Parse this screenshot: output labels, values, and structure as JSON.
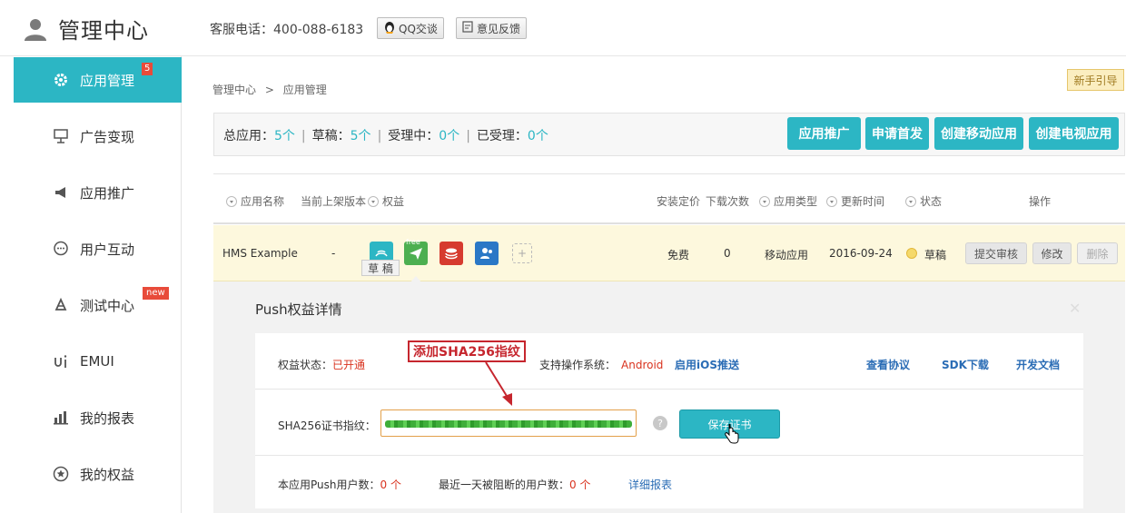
{
  "header": {
    "title": "管理中心",
    "hotline": "客服电话：400-088-6183",
    "qq_label": "QQ交谈",
    "feedback_label": "意见反馈"
  },
  "sidebar": {
    "items": [
      {
        "label": "应用管理",
        "icon": "gear-icon",
        "badge": "5"
      },
      {
        "label": "广告变现",
        "icon": "billboard-icon"
      },
      {
        "label": "应用推广",
        "icon": "megaphone-icon"
      },
      {
        "label": "用户互动",
        "icon": "chat-bubble-icon"
      },
      {
        "label": "测试中心",
        "icon": "test-icon",
        "badge": "new"
      },
      {
        "label": "EMUI",
        "icon": "emui-icon"
      },
      {
        "label": "我的报表",
        "icon": "bar-chart-icon"
      },
      {
        "label": "我的权益",
        "icon": "star-circle-icon"
      }
    ]
  },
  "breadcrumb": {
    "root": "管理中心",
    "sep": ">",
    "current": "应用管理"
  },
  "guide_label": "新手引导",
  "stats": {
    "total_label": "总应用：",
    "total_value": "5个",
    "draft_label": "草稿：",
    "draft_value": "5个",
    "pending_label": "受理中：",
    "pending_value": "0个",
    "accepted_label": "已受理：",
    "accepted_value": "0个"
  },
  "actions": [
    "应用推广",
    "申请首发",
    "创建移动应用",
    "创建电视应用"
  ],
  "table": {
    "headers": {
      "name": "应用名称",
      "version": "当前上架版本",
      "rights": "权益",
      "price": "安装定价",
      "downloads": "下载次数",
      "type": "应用类型",
      "updated": "更新时间",
      "status": "状态",
      "ops": "操作"
    },
    "row": {
      "name": "HMS Example",
      "version": "-",
      "price": "免费",
      "downloads": "0",
      "type": "移动应用",
      "updated": "2016-09-24",
      "status": "草稿",
      "draft_tag": "草 稿",
      "free_tag": "free",
      "btn_submit": "提交审核",
      "btn_edit": "修改",
      "btn_delete": "删除"
    }
  },
  "push_panel": {
    "title": "Push权益详情",
    "status_label": "权益状态：",
    "status_value": "已开通",
    "os_label": "支持操作系统：",
    "os_value": "Android",
    "ios_link": "启用iOS推送",
    "protocol_link": "查看协议",
    "sdk_link": "SDK下载",
    "docs_link": "开发文档",
    "sha_label": "SHA256证书指纹：",
    "save_label": "保存证书",
    "users_label": "本应用Push用户数：",
    "users_value": "0 个",
    "blocked_label": "最近一天被阻断的用户数：",
    "blocked_value": "0 个",
    "report_link": "详细报表",
    "annotation": "添加SHA256指纹"
  },
  "colors": {
    "accent": "#2cb6c4",
    "badge": "#e84b3a",
    "annotation": "#c6262e",
    "row_bg": "#fdf8dd"
  }
}
